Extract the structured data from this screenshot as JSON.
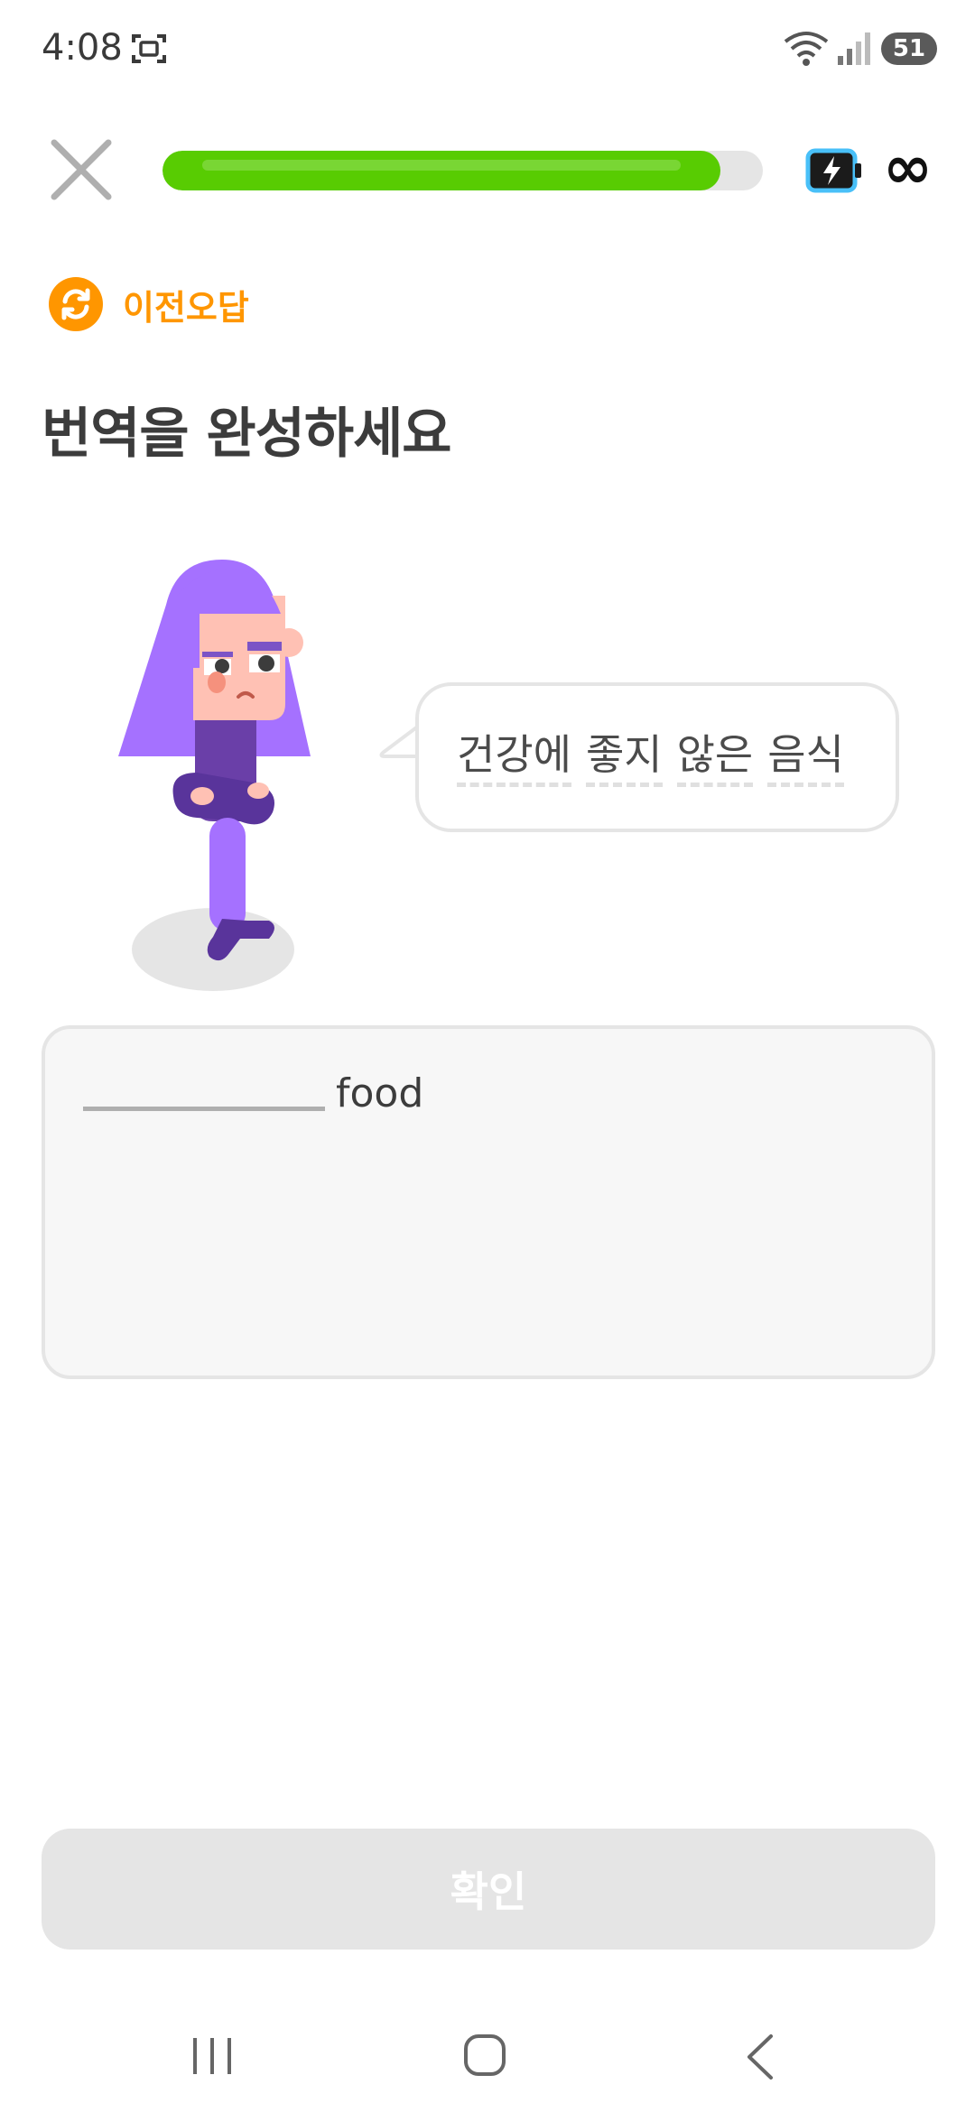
{
  "status_bar": {
    "time": "4:08",
    "battery_level": "51",
    "icons": [
      "screenshot-icon",
      "wifi-icon",
      "signal-icon",
      "battery-icon"
    ]
  },
  "lesson_header": {
    "progress_fraction": 0.93,
    "energy_icon": "battery-bolt-icon",
    "energy_value": "∞",
    "close_icon": "close-icon"
  },
  "mistake_tag": {
    "icon": "repeat-icon",
    "label": "이전오답"
  },
  "title": "번역을 완성하세요",
  "prompt": {
    "words": [
      "건강에",
      "좋지",
      "않은",
      "음식"
    ]
  },
  "answer": {
    "blank_value": "",
    "given_word": "food"
  },
  "check_button": {
    "label": "확인"
  },
  "colors": {
    "progress": "#58cc02",
    "progress_track": "#e5e5e5",
    "mistake_orange": "#ff9600",
    "character_purple": "#a571ff",
    "button_disabled": "#e5e5e5"
  },
  "nav": {
    "icons": [
      "recents-icon",
      "home-icon",
      "back-icon"
    ]
  }
}
